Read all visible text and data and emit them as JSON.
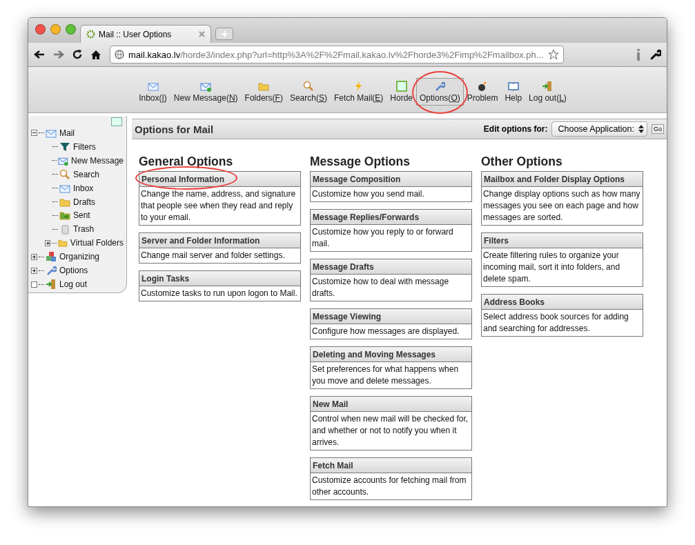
{
  "browser": {
    "tab_title": "Mail :: User Options",
    "url_host": "mail.kakao.lv",
    "url_path": "/horde3/index.php?url=http%3A%2F%2Fmail.kakao.lv%2Fhorde3%2Fimp%2Fmailbox.ph..."
  },
  "toolbar": [
    {
      "kind": "inbox",
      "label": "Inbox(",
      "key": "I",
      "tail": ")",
      "circled": false
    },
    {
      "kind": "compose",
      "label": "New Message(",
      "key": "N",
      "tail": ")",
      "circled": false
    },
    {
      "kind": "folder",
      "label": "Folders(",
      "key": "F",
      "tail": ")",
      "circled": false
    },
    {
      "kind": "search",
      "label": "Search(",
      "key": "S",
      "tail": ")",
      "circled": false
    },
    {
      "kind": "fetch",
      "label": "Fetch Mail(",
      "key": "E",
      "tail": ")",
      "circled": false
    },
    {
      "kind": "horde",
      "label": "Horde",
      "circled": false
    },
    {
      "kind": "options",
      "label": "Options(",
      "key": "O",
      "tail": ")",
      "circled": true
    },
    {
      "kind": "problem",
      "label": "Problem",
      "circled": false
    },
    {
      "kind": "help",
      "label": "Help",
      "circled": false
    },
    {
      "kind": "logout",
      "label": "Log out(",
      "key": "L",
      "tail": ")",
      "circled": false
    }
  ],
  "sidebar": {
    "items": [
      {
        "kind": "inbox",
        "label": "Mail",
        "expanded": true,
        "children": [
          {
            "kind": "filter",
            "label": "Filters"
          },
          {
            "kind": "compose",
            "label": "New Message"
          },
          {
            "kind": "search",
            "label": "Search"
          },
          {
            "kind": "inbox",
            "label": "Inbox"
          },
          {
            "kind": "drafts",
            "label": "Drafts"
          },
          {
            "kind": "sent",
            "label": "Sent"
          },
          {
            "kind": "trash",
            "label": "Trash"
          },
          {
            "kind": "folder",
            "label": "Virtual Folders",
            "expanded": false
          }
        ]
      },
      {
        "kind": "organizing",
        "label": "Organizing",
        "expanded": false
      },
      {
        "kind": "options",
        "label": "Options",
        "expanded": false
      },
      {
        "kind": "logout",
        "label": "Log out"
      }
    ]
  },
  "header": {
    "title": "Options for Mail",
    "edit_label": "Edit options for:",
    "select_value": "Choose Application:",
    "go_button": "Go"
  },
  "columns": [
    {
      "title": "General Options",
      "groups": [
        {
          "title": "Personal Information",
          "description": "Change the name, address, and signature that people see when they read and reply to your email.",
          "circled": true
        },
        {
          "title": "Server and Folder Information",
          "description": "Change mail server and folder settings.",
          "circled": false
        },
        {
          "title": "Login Tasks",
          "description": "Customize tasks to run upon logon to Mail.",
          "circled": false
        }
      ]
    },
    {
      "title": "Message Options",
      "groups": [
        {
          "title": "Message Composition",
          "description": "Customize how you send mail.",
          "circled": false
        },
        {
          "title": "Message Replies/Forwards",
          "description": "Customize how you reply to or forward mail.",
          "circled": false
        },
        {
          "title": "Message Drafts",
          "description": "Customize how to deal with message drafts.",
          "circled": false
        },
        {
          "title": "Message Viewing",
          "description": "Configure how messages are displayed.",
          "circled": false
        },
        {
          "title": "Deleting and Moving Messages",
          "description": "Set preferences for what happens when you move and delete messages.",
          "circled": false
        },
        {
          "title": "New Mail",
          "description": "Control when new mail will be checked for, and whether or not to notify you when it arrives.",
          "circled": false
        },
        {
          "title": "Fetch Mail",
          "description": "Customize accounts for fetching mail from other accounts.",
          "circled": false
        }
      ]
    },
    {
      "title": "Other Options",
      "groups": [
        {
          "title": "Mailbox and Folder Display Options",
          "description": "Change display options such as how many messages you see on each page and how messages are sorted.",
          "circled": false
        },
        {
          "title": "Filters",
          "description": "Create filtering rules to organize your incoming mail, sort it into folders, and delete spam.",
          "circled": false
        },
        {
          "title": "Address Books",
          "description": "Select address book sources for adding and searching for addresses.",
          "circled": false
        }
      ]
    }
  ]
}
